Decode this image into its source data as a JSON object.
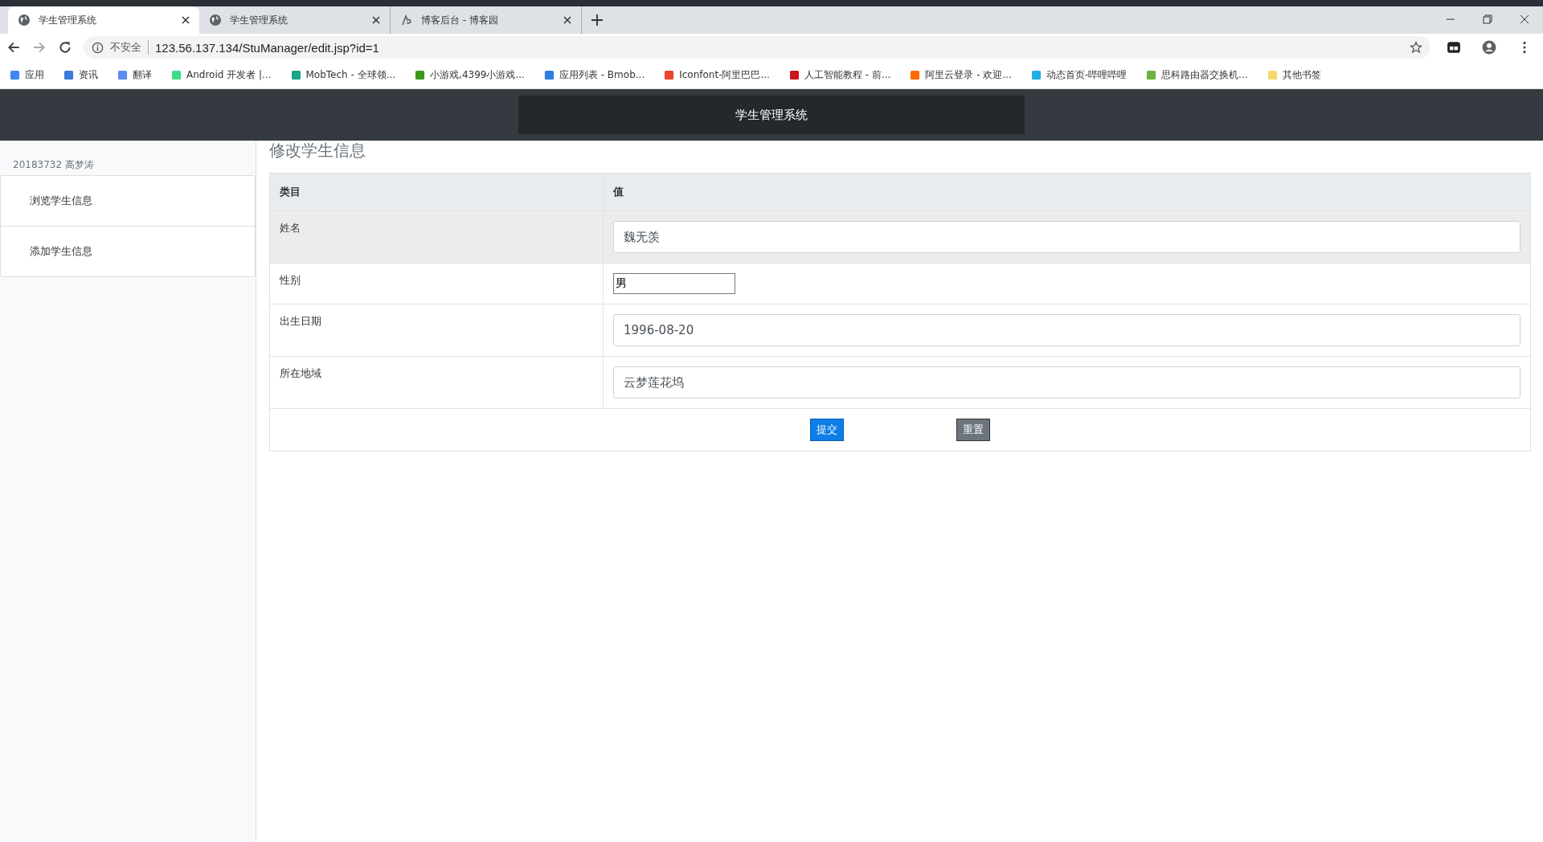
{
  "browser": {
    "tabs": [
      {
        "title": "学生管理系统",
        "selected": true,
        "kind": "globe"
      },
      {
        "title": "学生管理系统",
        "selected": false,
        "kind": "globe"
      },
      {
        "title": "博客后台 - 博客园",
        "selected": false,
        "kind": "blog"
      }
    ],
    "address": {
      "security": "不安全",
      "url": "123.56.137.134/StuManager/edit.jsp?id=1"
    },
    "bookmarks": [
      {
        "label": "应用",
        "color": "#4285f4"
      },
      {
        "label": "资讯",
        "color": "#3b7bd8"
      },
      {
        "label": "翻译",
        "color": "#5a8dee"
      },
      {
        "label": "Android 开发者 |...",
        "color": "#3ddc84"
      },
      {
        "label": "MobTech - 全球领...",
        "color": "#19a58a"
      },
      {
        "label": "小游戏,4399小游戏...",
        "color": "#3a9a1e"
      },
      {
        "label": "应用列表 - Bmob...",
        "color": "#2f7de1"
      },
      {
        "label": "Iconfont-阿里巴巴...",
        "color": "#e8452c"
      },
      {
        "label": "人工智能教程 - 前...",
        "color": "#c8161d"
      },
      {
        "label": "阿里云登录 - 欢迎...",
        "color": "#ff6a00"
      },
      {
        "label": "动态首页-哔哩哔哩",
        "color": "#23ade5"
      },
      {
        "label": "思科路由器交换机...",
        "color": "#6cb33f"
      },
      {
        "label": "其他书签",
        "color": "#f6d66e"
      }
    ]
  },
  "header": {
    "title": "学生管理系统"
  },
  "sidebar": {
    "user": "20183732 高梦涛",
    "items": [
      {
        "label": "浏览学生信息"
      },
      {
        "label": "添加学生信息"
      }
    ]
  },
  "page": {
    "title": "修改学生信息",
    "table": {
      "columns": [
        "类目",
        "值"
      ],
      "rows": [
        {
          "label": "姓名",
          "value": "魏无羡",
          "kind": "wide",
          "highlighted": true
        },
        {
          "label": "性别",
          "value": "男",
          "kind": "plain",
          "highlighted": false
        },
        {
          "label": "出生日期",
          "value": "1996-08-20",
          "kind": "wide",
          "highlighted": false
        },
        {
          "label": "所在地域",
          "value": "云梦莲花坞",
          "kind": "wide",
          "highlighted": false
        }
      ]
    },
    "buttons": [
      {
        "label": "提交",
        "kind": "primary"
      },
      {
        "label": "重置",
        "kind": "secondary"
      }
    ]
  }
}
